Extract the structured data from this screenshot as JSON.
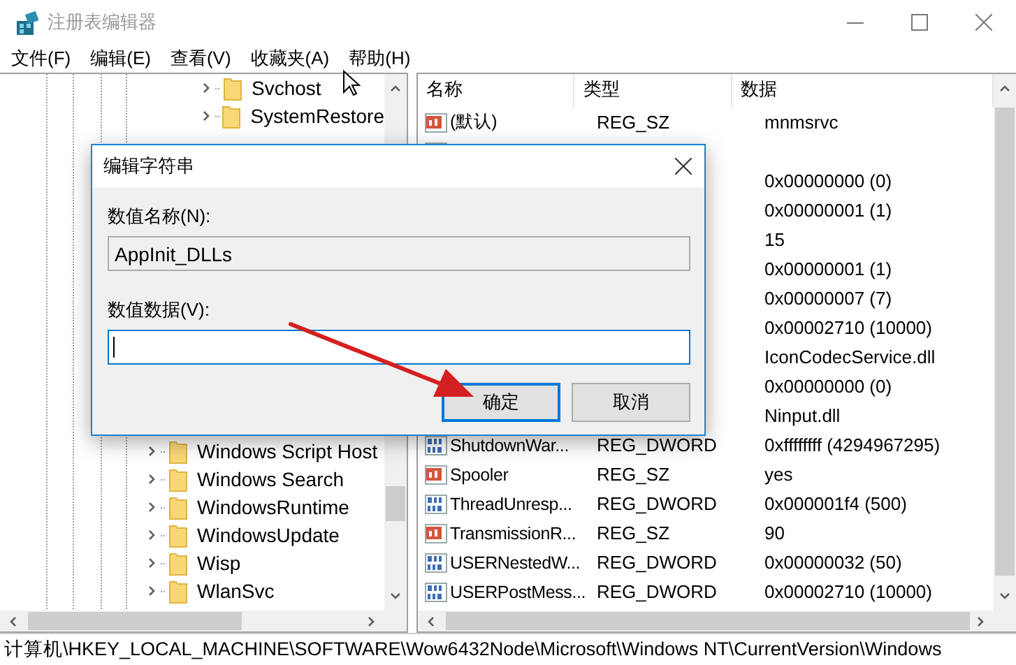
{
  "window": {
    "title": "注册表编辑器"
  },
  "menu": [
    "文件(F)",
    "编辑(E)",
    "查看(V)",
    "收藏夹(A)",
    "帮助(H)"
  ],
  "tree": {
    "nested_nodes": [
      {
        "label": "Svchost",
        "expanded": false
      },
      {
        "label": "SystemRestore",
        "expanded": false
      }
    ],
    "nodes": [
      {
        "label": "Windows Script Host",
        "expanded": false
      },
      {
        "label": "Windows Search",
        "expanded": false
      },
      {
        "label": "WindowsRuntime",
        "expanded": false
      },
      {
        "label": "WindowsUpdate",
        "expanded": false
      },
      {
        "label": "Wisp",
        "expanded": false
      },
      {
        "label": "WlanSvc",
        "expanded": false
      }
    ]
  },
  "values": {
    "columns": [
      "名称",
      "类型",
      "数据"
    ],
    "rows": [
      {
        "kind": "string",
        "name": "(默认)",
        "type": "REG_SZ",
        "data": "mnmsrvc"
      },
      {
        "kind": "binary"
      },
      {
        "data": "0x00000000 (0)"
      },
      {
        "data": "0x00000001 (1)"
      },
      {
        "data": "15"
      },
      {
        "data": "0x00000001 (1)"
      },
      {
        "data": "0x00000007 (7)"
      },
      {
        "data": "0x00002710 (10000)"
      },
      {
        "data": "IconCodecService.dll"
      },
      {
        "data": "0x00000000 (0)"
      },
      {
        "data": "Ninput.dll"
      },
      {
        "kind": "binary",
        "name": "ShutdownWar...",
        "type": "REG_DWORD",
        "data": "0xffffffff (4294967295)"
      },
      {
        "kind": "string",
        "name": "Spooler",
        "type": "REG_SZ",
        "data": "yes"
      },
      {
        "kind": "binary",
        "name": "ThreadUnresp...",
        "type": "REG_DWORD",
        "data": "0x000001f4 (500)"
      },
      {
        "kind": "string",
        "name": "TransmissionR...",
        "type": "REG_SZ",
        "data": "90"
      },
      {
        "kind": "binary",
        "name": "USERNestedW...",
        "type": "REG_DWORD",
        "data": "0x00000032 (50)"
      },
      {
        "kind": "binary",
        "name": "USERPostMess...",
        "type": "REG_DWORD",
        "data": "0x00002710 (10000)"
      }
    ]
  },
  "dialog": {
    "title": "编辑字符串",
    "name_label": "数值名称(N):",
    "name_value": "AppInit_DLLs",
    "data_label": "数值数据(V):",
    "data_field": {
      "focused": true
    },
    "buttons": [
      {
        "label": "确定",
        "default": true
      },
      {
        "label": "取消",
        "default": false
      }
    ]
  },
  "status_bar": "计算机\\HKEY_LOCAL_MACHINE\\SOFTWARE\\Wow6432Node\\Microsoft\\Windows NT\\CurrentVersion\\Windows"
}
